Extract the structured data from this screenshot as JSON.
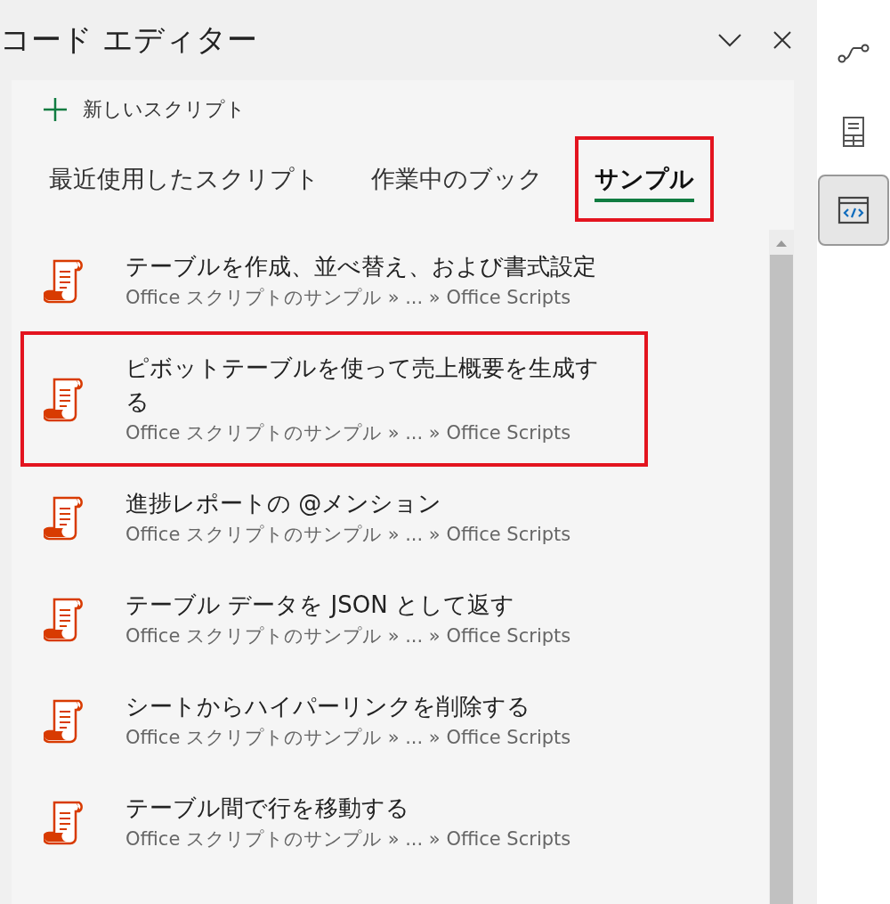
{
  "panel": {
    "title": "コード エディター"
  },
  "new_script": {
    "label": "新しいスクリプト"
  },
  "tabs": [
    {
      "label": "最近使用したスクリプト",
      "selected": false,
      "highlighted": false
    },
    {
      "label": "作業中のブック",
      "selected": false,
      "highlighted": false
    },
    {
      "label": "サンプル",
      "selected": true,
      "highlighted": true
    }
  ],
  "scripts": [
    {
      "title": "テーブルを作成、並べ替え、および書式設定",
      "path": "Office スクリプトのサンプル » ... » Office Scripts",
      "highlighted": false
    },
    {
      "title": "ピボットテーブルを使って売上概要を生成する",
      "path": "Office スクリプトのサンプル » ... » Office Scripts",
      "highlighted": true
    },
    {
      "title": "進捗レポートの @メンション",
      "path": "Office スクリプトのサンプル » ... » Office Scripts",
      "highlighted": false
    },
    {
      "title": "テーブル データを JSON として返す",
      "path": "Office スクリプトのサンプル » ... » Office Scripts",
      "highlighted": false
    },
    {
      "title": "シートからハイパーリンクを削除する",
      "path": "Office スクリプトのサンプル » ... » Office Scripts",
      "highlighted": false
    },
    {
      "title": "テーブル間で行を移動する",
      "path": "Office スクリプトのサンプル » ... » Office Scripts",
      "highlighted": false
    }
  ],
  "rail": [
    {
      "kind": "flow",
      "selected": false
    },
    {
      "kind": "form",
      "selected": false
    },
    {
      "kind": "code",
      "selected": true
    }
  ]
}
